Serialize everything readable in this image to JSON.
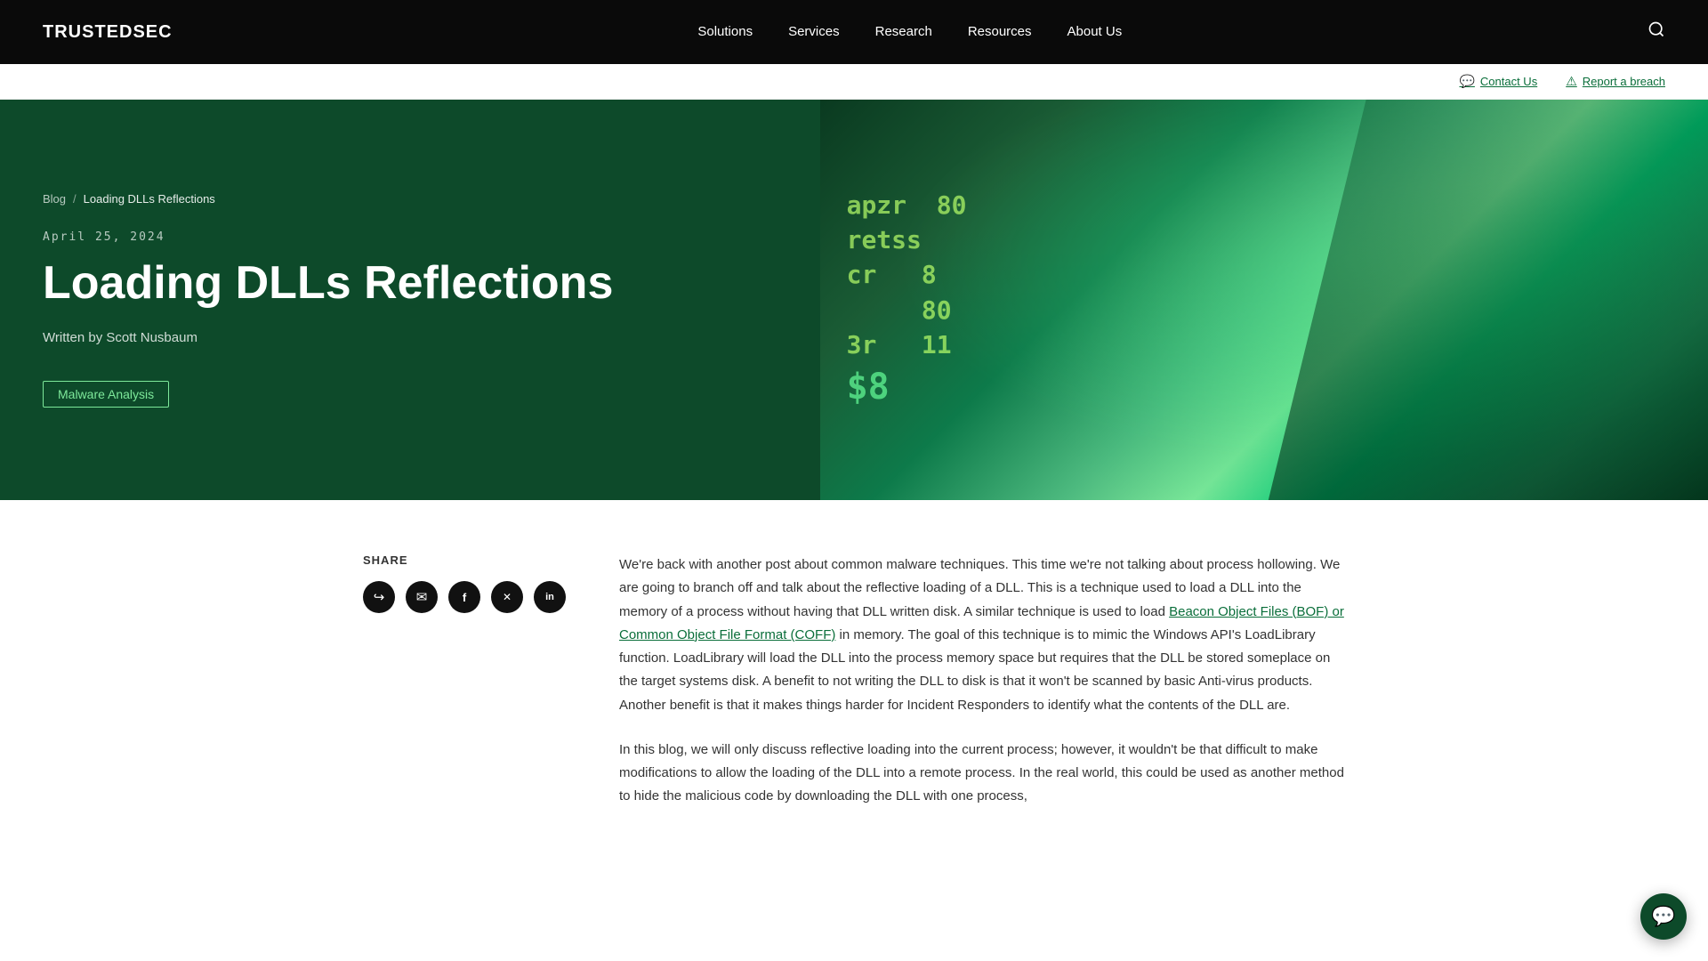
{
  "brand": {
    "logo": "TRUSTEDSEC"
  },
  "nav": {
    "links": [
      {
        "id": "solutions",
        "label": "Solutions"
      },
      {
        "id": "services",
        "label": "Services"
      },
      {
        "id": "research",
        "label": "Research"
      },
      {
        "id": "resources",
        "label": "Resources"
      },
      {
        "id": "about",
        "label": "About Us"
      }
    ]
  },
  "secondary_bar": {
    "contact_label": "Contact Us",
    "breach_label": "Report a breach"
  },
  "hero": {
    "breadcrumb_blog": "Blog",
    "breadcrumb_sep": "/",
    "breadcrumb_current": "Loading DLLs Reflections",
    "date": "April 25, 2024",
    "title": "Loading DLLs Reflections",
    "author": "Written by Scott Nusbaum",
    "tag": "Malware Analysis",
    "cyber_lines": [
      "apzr  80",
      "retss  8",
      "cr    80",
      "3r    11"
    ]
  },
  "share": {
    "label": "Share",
    "icons": [
      {
        "id": "share-forward",
        "symbol": "↪"
      },
      {
        "id": "share-email",
        "symbol": "✉"
      },
      {
        "id": "share-facebook",
        "symbol": "f"
      },
      {
        "id": "share-x",
        "symbol": "✕"
      },
      {
        "id": "share-linkedin",
        "symbol": "in"
      }
    ]
  },
  "article": {
    "paragraph1": "We're back with another post about common malware techniques. This time we're not talking about process hollowing. We are going to branch off and talk about the reflective loading of a DLL. This is a technique used to load a DLL into the memory of a process without having that DLL written disk. A similar technique is used to load Beacon Object Files (BOF) or Common Object File Format (COFF) in memory. The goal of this technique is to mimic the Windows API's LoadLibrary function. LoadLibrary will load the DLL into the process memory space but requires that the DLL be stored someplace on the target systems disk. A benefit to not writing the DLL to disk is that it won't be scanned by basic Anti-virus products. Another benefit is that it makes things harder for Incident Responders to identify what the contents of the DLL are.",
    "paragraph1_link_text": "Beacon Object Files (BOF) or Common Object File Format (COFF)",
    "paragraph2": "In this blog, we will only discuss reflective loading into the current process; however, it wouldn't be that difficult to make modifications to allow the loading of the DLL into a remote process. In the real world, this could be used as another method to hide the malicious code by downloading the DLL with one process,"
  },
  "chat": {
    "icon": "💬"
  }
}
